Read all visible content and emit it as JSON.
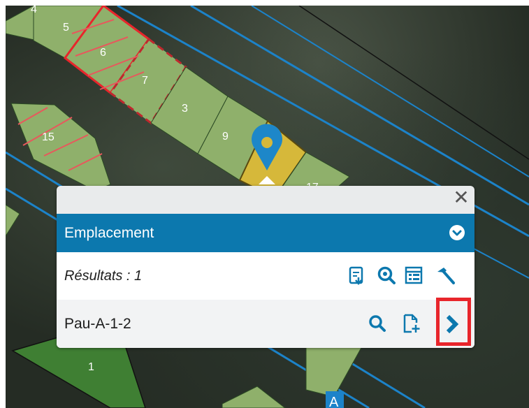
{
  "map": {
    "parcels": [
      {
        "label": "4"
      },
      {
        "label": "5"
      },
      {
        "label": "6"
      },
      {
        "label": "7"
      },
      {
        "label": "3"
      },
      {
        "label": "9"
      },
      {
        "label": "15"
      },
      {
        "label": "1"
      },
      {
        "label": "17"
      }
    ],
    "marker_badge": "A",
    "colors": {
      "parcel_fill": "#8fb06b",
      "selected_parcel_fill": "#d6b83a",
      "dark_parcel_fill": "#3f7f33",
      "boundary_red": "#e8252b",
      "line_blue": "#1c83c9",
      "marker_blue": "#1d87c9"
    }
  },
  "popup": {
    "close_icon": "close-icon",
    "header_title": "Emplacement",
    "header_icon": "chevron-down-circle-icon",
    "results_label": "Résultats : 1",
    "results_actions": [
      "export-report-icon",
      "zoom-search-icon",
      "table-view-icon",
      "hammer-icon"
    ],
    "item_label": "Pau-A-1-2",
    "item_actions": [
      "search-icon",
      "add-document-icon",
      "chevron-right-icon"
    ],
    "highlight_color": "#e8252b",
    "accent": "#0c78ae"
  }
}
